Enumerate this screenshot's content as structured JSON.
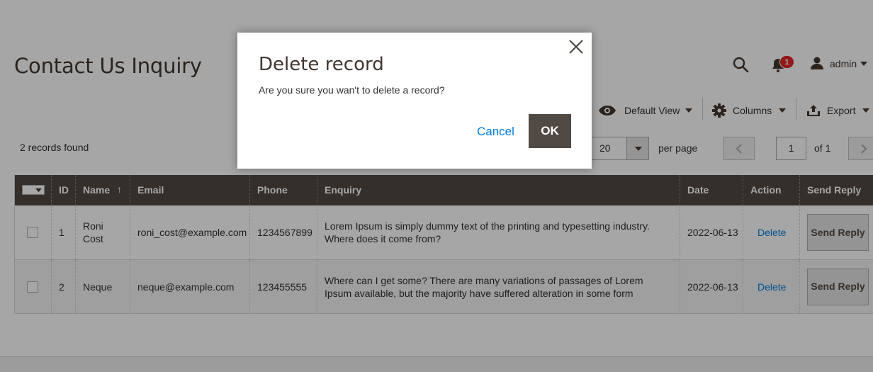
{
  "header": {
    "title": "Contact Us Inquiry",
    "notification_count": "1",
    "user_name": "admin"
  },
  "toolbar": {
    "default_view": "Default View",
    "columns": "Columns",
    "export": "Export"
  },
  "grid_controls": {
    "records_found": "2 records found",
    "per_page_value": "20",
    "per_page_label": "per page",
    "current_page": "1",
    "of_pages": "of 1"
  },
  "table": {
    "columns": [
      "ID",
      "Name",
      "Email",
      "Phone",
      "Enquiry",
      "Date",
      "Action",
      "Send Reply"
    ],
    "sort_indicator": "↑",
    "rows": [
      {
        "id": "1",
        "name": "Roni Cost",
        "email": "roni_cost@example.com",
        "phone": "1234567899",
        "enquiry": "Lorem Ipsum is simply dummy text of the printing and typesetting industry. Where does it come from?",
        "date": "2022-06-13",
        "action": "Delete",
        "reply_button": "Send Reply"
      },
      {
        "id": "2",
        "name": "Neque",
        "email": "neque@example.com",
        "phone": "123455555",
        "enquiry": "Where can I get some? There are many variations of passages of Lorem Ipsum available, but the majority have suffered alteration in some form",
        "date": "2022-06-13",
        "action": "Delete",
        "reply_button": "Send Reply"
      }
    ]
  },
  "modal": {
    "title": "Delete record",
    "message": "Are you sure you wan't to delete a record?",
    "cancel_label": "Cancel",
    "ok_label": "OK"
  },
  "colors": {
    "header_bg": "#514943",
    "link": "#007bdb",
    "badge": "#e22626"
  }
}
